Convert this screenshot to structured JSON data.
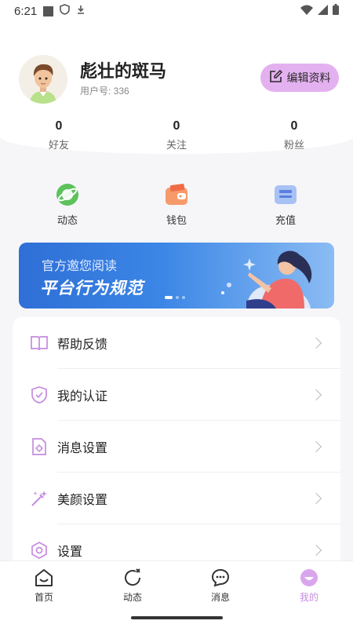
{
  "status": {
    "time": "6:21"
  },
  "profile": {
    "nickname": "彪壮的斑马",
    "user_id": "用户号: 336",
    "edit_label": "编辑资料"
  },
  "stats": [
    {
      "value": "0",
      "label": "好友"
    },
    {
      "value": "0",
      "label": "关注"
    },
    {
      "value": "0",
      "label": "粉丝"
    }
  ],
  "quick_actions": [
    {
      "label": "动态",
      "icon": "planet-icon"
    },
    {
      "label": "钱包",
      "icon": "wallet-icon"
    },
    {
      "label": "充值",
      "icon": "card-icon"
    }
  ],
  "banner": {
    "subtitle": "官方邀您阅读",
    "title": "平台行为规范",
    "page_count": 3,
    "active_page": 1
  },
  "menu": [
    {
      "label": "帮助反馈",
      "icon": "book-icon"
    },
    {
      "label": "我的认证",
      "icon": "shield-check-icon"
    },
    {
      "label": "消息设置",
      "icon": "message-settings-icon"
    },
    {
      "label": "美颜设置",
      "icon": "magic-wand-icon"
    },
    {
      "label": "设置",
      "icon": "hexagon-gear-icon"
    }
  ],
  "tabs": [
    {
      "label": "首页",
      "icon": "home-icon",
      "active": false
    },
    {
      "label": "动态",
      "icon": "refresh-icon",
      "active": false
    },
    {
      "label": "消息",
      "icon": "chat-icon",
      "active": false
    },
    {
      "label": "我的",
      "icon": "profile-face-icon",
      "active": true
    }
  ],
  "colors": {
    "accent": "#c58be0",
    "edit_button_bg": "#e4b1f0",
    "banner_blue": "#2f6fd6"
  }
}
